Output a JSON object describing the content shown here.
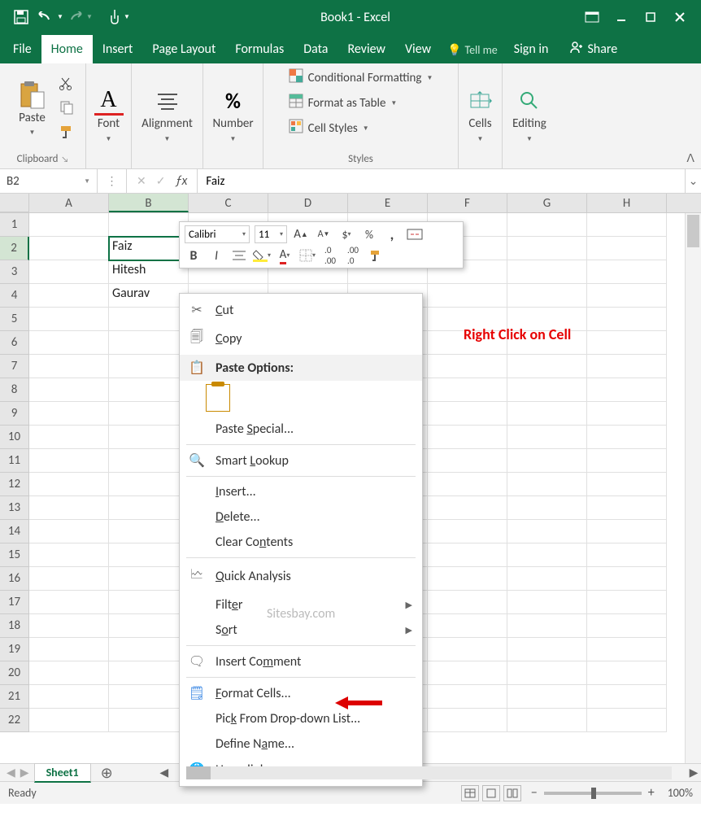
{
  "titlebar": {
    "title": "Book1 - Excel"
  },
  "tabs": {
    "file": "File",
    "home": "Home",
    "insert": "Insert",
    "page_layout": "Page Layout",
    "formulas": "Formulas",
    "data": "Data",
    "review": "Review",
    "view": "View",
    "tell_me": "Tell me",
    "sign_in": "Sign in",
    "share": "Share"
  },
  "ribbon": {
    "clipboard": {
      "label": "Clipboard",
      "paste": "Paste"
    },
    "font": {
      "label": "Font"
    },
    "alignment": {
      "label": "Alignment"
    },
    "number": {
      "label": "Number",
      "symbol": "%"
    },
    "styles": {
      "label": "Styles",
      "conditional": "Conditional Formatting",
      "table": "Format as Table",
      "cell_styles": "Cell Styles"
    },
    "cells": {
      "label": "Cells"
    },
    "editing": {
      "label": "Editing"
    }
  },
  "namebox": "B2",
  "formula_value": "Faiz",
  "columns": [
    "A",
    "B",
    "C",
    "D",
    "E",
    "F",
    "G",
    "H"
  ],
  "rows": [
    1,
    2,
    3,
    4,
    5,
    6,
    7,
    8,
    9,
    10,
    11,
    12,
    13,
    14,
    15,
    16,
    17,
    18,
    19,
    20,
    21,
    22
  ],
  "cells": {
    "B2": "Faiz",
    "B3": "Hitesh",
    "B4": "Gaurav"
  },
  "active_cell": "B2",
  "minitoolbar": {
    "font": "Calibri",
    "size": "11"
  },
  "context_menu": {
    "cut": "Cut",
    "copy": "Copy",
    "paste_options": "Paste Options:",
    "paste_special": "Paste Special...",
    "smart_lookup": "Smart Lookup",
    "insert": "Insert...",
    "delete": "Delete...",
    "clear": "Clear Contents",
    "quick_analysis": "Quick Analysis",
    "filter": "Filter",
    "sort": "Sort",
    "insert_comment": "Insert Comment",
    "format_cells": "Format Cells...",
    "pick_list": "Pick From Drop-down List...",
    "define_name": "Define Name...",
    "hyperlink": "Hyperlink..."
  },
  "annotation_text": "Right Click on Cell",
  "watermark_text": "Sitesbay.com",
  "sheets": {
    "sheet1": "Sheet1"
  },
  "statusbar": {
    "ready": "Ready",
    "zoom": "100%"
  }
}
